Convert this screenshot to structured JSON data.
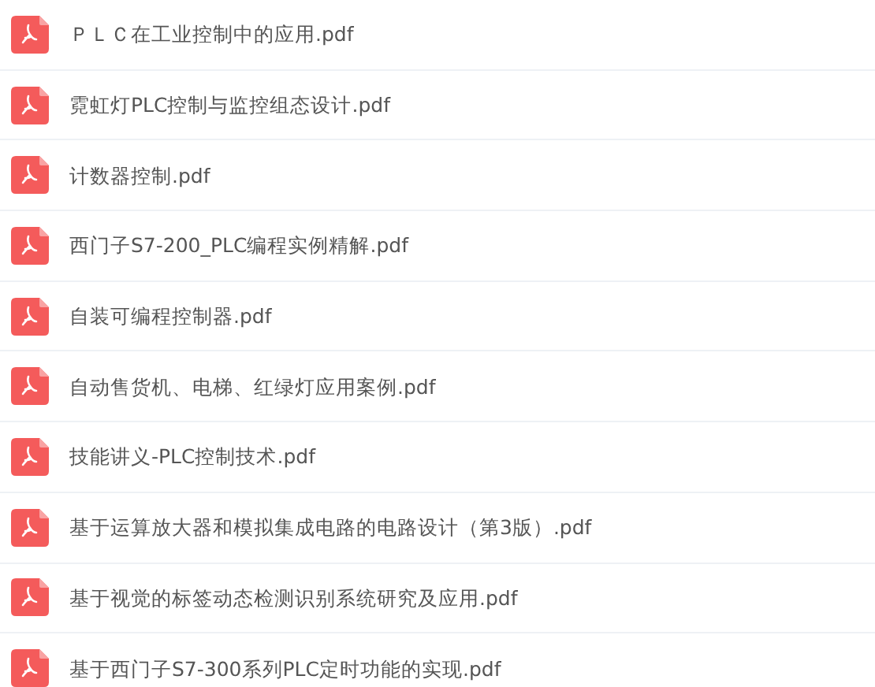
{
  "files": [
    {
      "name": "ＰＬＣ在工业控制中的应用.pdf"
    },
    {
      "name": "霓虹灯PLC控制与监控组态设计.pdf"
    },
    {
      "name": "计数器控制.pdf"
    },
    {
      "name": "西门子S7-200_PLC编程实例精解.pdf"
    },
    {
      "name": "自装可编程控制器.pdf"
    },
    {
      "name": "自动售货机、电梯、红绿灯应用案例.pdf"
    },
    {
      "name": "技能讲义-PLC控制技术.pdf"
    },
    {
      "name": "基于运算放大器和模拟集成电路的电路设计（第3版）.pdf"
    },
    {
      "name": "基于视觉的标签动态检测识别系统研究及应用.pdf"
    },
    {
      "name": "基于西门子S7-300系列PLC定时功能的实现.pdf"
    }
  ]
}
